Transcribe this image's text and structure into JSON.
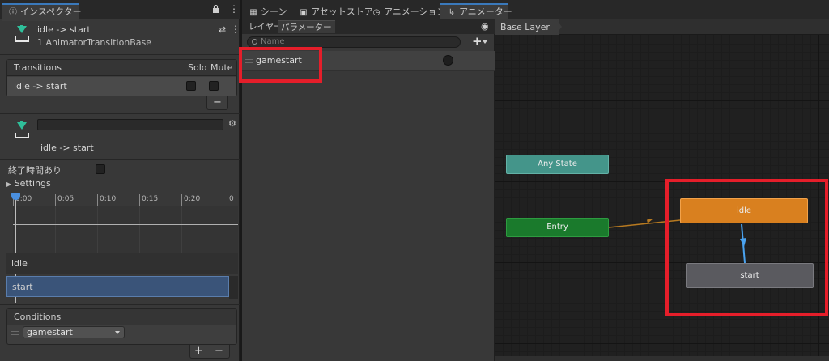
{
  "inspector": {
    "tab_label": "インスペクター",
    "selection_title": "idle -> start",
    "selection_subtitle": "1 AnimatorTransitionBase",
    "transitions": {
      "header": "Transitions",
      "solo_label": "Solo",
      "mute_label": "Mute",
      "rows": [
        {
          "label": "idle -> start",
          "solo": false,
          "mute": false
        }
      ],
      "remove_label": "−"
    },
    "transition_name": "idle -> start",
    "has_exit_time_label": "終了時間あり",
    "has_exit_time": false,
    "settings_label": "Settings",
    "timeline": {
      "ticks": [
        "0:00",
        "0:05",
        "0:10",
        "0:15",
        "0:20",
        "0"
      ],
      "state_from": "idle",
      "state_to": "start"
    },
    "conditions": {
      "header": "Conditions",
      "items": [
        {
          "parameter": "gamestart"
        }
      ],
      "add_label": "+",
      "remove_label": "−"
    }
  },
  "animator": {
    "tabs": [
      {
        "label": "シーン",
        "icon": "grid-icon"
      },
      {
        "label": "アセットストア",
        "icon": "store-bag-icon"
      },
      {
        "label": "アニメーション",
        "icon": "animation-clock-icon"
      },
      {
        "label": "アニメーター",
        "icon": "animator-icon",
        "active": true
      }
    ],
    "subtabs": {
      "layers": "レイヤー",
      "parameters": "パラメーター"
    },
    "search_placeholder": "Name",
    "add_label": "+",
    "parameters": [
      {
        "name": "gamestart",
        "type": "trigger"
      }
    ],
    "breadcrumb": "Base Layer",
    "nodes": {
      "any_state": "Any State",
      "entry": "Entry",
      "idle": "idle",
      "start": "start"
    }
  },
  "colors": {
    "highlight_red": "#e51e2a",
    "any_state": "#44958a",
    "entry": "#1a7a2c",
    "idle_default": "#d9801f",
    "start_state": "#5a5a5f",
    "transition_entry": "#b87a20",
    "transition_selected": "#4aa3f0"
  }
}
